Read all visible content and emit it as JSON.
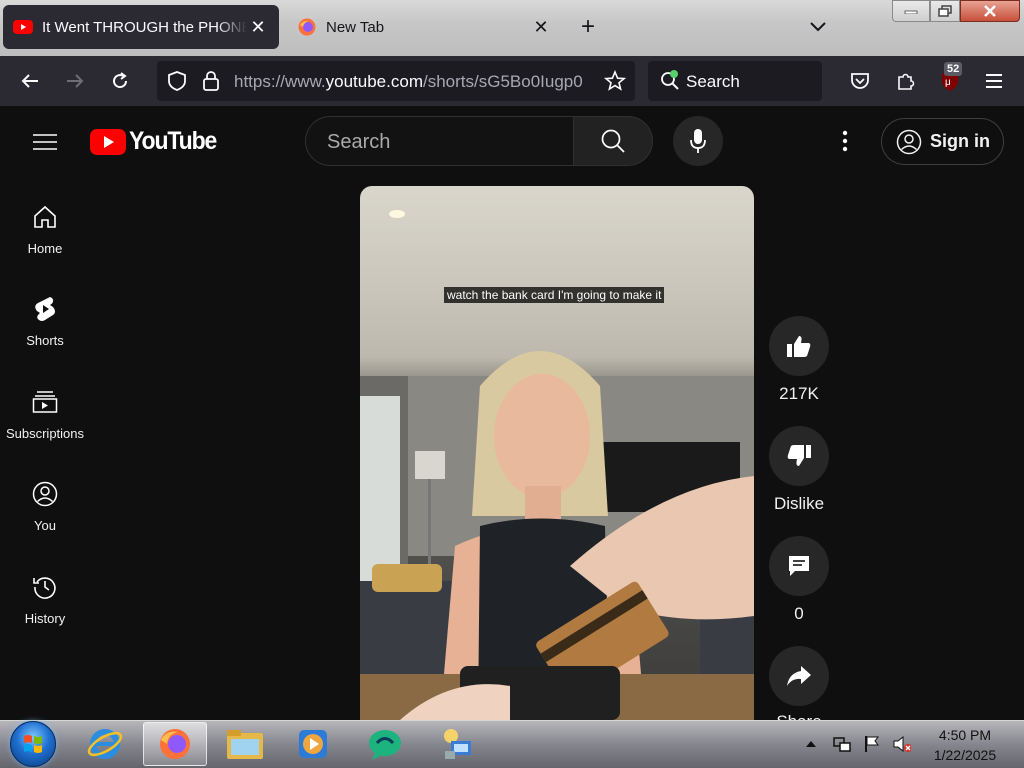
{
  "browser": {
    "tabs": [
      {
        "title": "It Went THROUGH the PHONE",
        "icon": "youtube-icon",
        "active": true
      },
      {
        "title": "New Tab",
        "icon": "firefox-icon",
        "active": false
      }
    ],
    "url_prefix": "https://www.",
    "url_domain": "youtube.com",
    "url_path": "/shorts/sG5Bo0Iugp0",
    "search_placeholder": "Search",
    "extension_badge": "52",
    "accent": "#2b2a33"
  },
  "youtube": {
    "logo_text": "YouTube",
    "search_placeholder": "Search",
    "sign_in_label": "Sign in",
    "brand_color": "#ff0000",
    "sidebar": [
      {
        "label": "Home",
        "icon": "home-icon"
      },
      {
        "label": "Shorts",
        "icon": "shorts-icon"
      },
      {
        "label": "Subscriptions",
        "icon": "subscriptions-icon"
      },
      {
        "label": "You",
        "icon": "you-icon"
      },
      {
        "label": "History",
        "icon": "history-icon"
      }
    ],
    "short": {
      "caption": "watch the bank card I'm going to make it",
      "likes": "217K",
      "dislike_label": "Dislike",
      "comments": "0",
      "share_label": "Share"
    }
  },
  "taskbar": {
    "pinned": [
      "ie-icon",
      "firefox-icon",
      "explorer-icon",
      "media-player-icon",
      "chat-app-icon",
      "network-app-icon"
    ],
    "time": "4:50 PM",
    "date": "1/22/2025"
  }
}
